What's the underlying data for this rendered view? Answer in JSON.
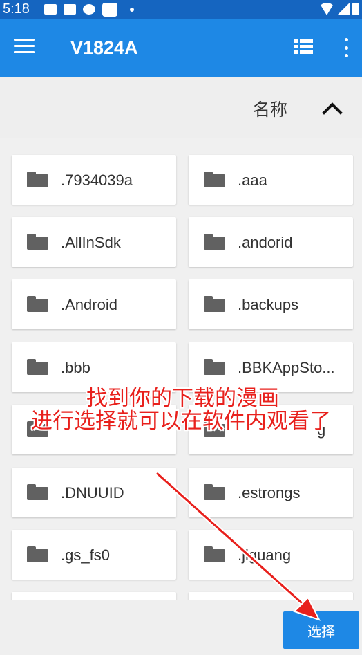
{
  "status_bar": {
    "time": "5:18"
  },
  "app_bar": {
    "title": "V1824A"
  },
  "sort_bar": {
    "label": "名称"
  },
  "folders": [
    {
      "name": ".7934039a"
    },
    {
      "name": ".aaa"
    },
    {
      "name": ".AllInSdk"
    },
    {
      "name": ".andorid"
    },
    {
      "name": ".Android"
    },
    {
      "name": ".backups"
    },
    {
      "name": ".bbb"
    },
    {
      "name": ".BBKAppSto..."
    },
    {
      "name": ""
    },
    {
      "name": "g"
    },
    {
      "name": ".DNUUID"
    },
    {
      "name": ".estrongs"
    },
    {
      "name": ".gs_fs0"
    },
    {
      "name": ".jiguang"
    },
    {
      "name": ""
    },
    {
      "name": ""
    }
  ],
  "bottom_bar": {
    "select_label": "选择"
  },
  "annotation": {
    "line1": "找到你的下载的漫画",
    "line2": "进行选择就可以在软件内观看了"
  },
  "colors": {
    "status_bar": "#1565c0",
    "app_bar": "#1e88e5",
    "select_button": "#1e88e5",
    "annotation_text": "#e8201c",
    "folder_icon": "#616161"
  }
}
